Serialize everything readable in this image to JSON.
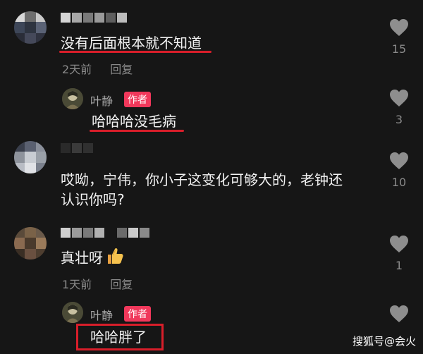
{
  "comments": [
    {
      "text": "没有后面根本就不知道",
      "time": "2天前",
      "reply": "回复",
      "likes": "15"
    },
    {
      "author_name": "叶静",
      "author_tag": "作者",
      "text": "哈哈哈没毛病",
      "likes": "3"
    },
    {
      "text_line1": "哎呦，宁伟，你小子这变化可够大的，老钟还",
      "text_line2": "认识你吗?",
      "likes": "10"
    },
    {
      "text": "真壮呀",
      "time": "1天前",
      "reply": "回复",
      "likes": "1"
    },
    {
      "author_name": "叶静",
      "author_tag": "作者",
      "text": "哈哈胖了"
    }
  ],
  "watermark": "搜狐号@会火",
  "icons": {
    "like": "heart-icon",
    "thumbs_up": "thumbs-up-emoji"
  },
  "colors": {
    "background": "#161616",
    "highlight_red": "#d81e2a",
    "author_tag": "#f0385b"
  }
}
